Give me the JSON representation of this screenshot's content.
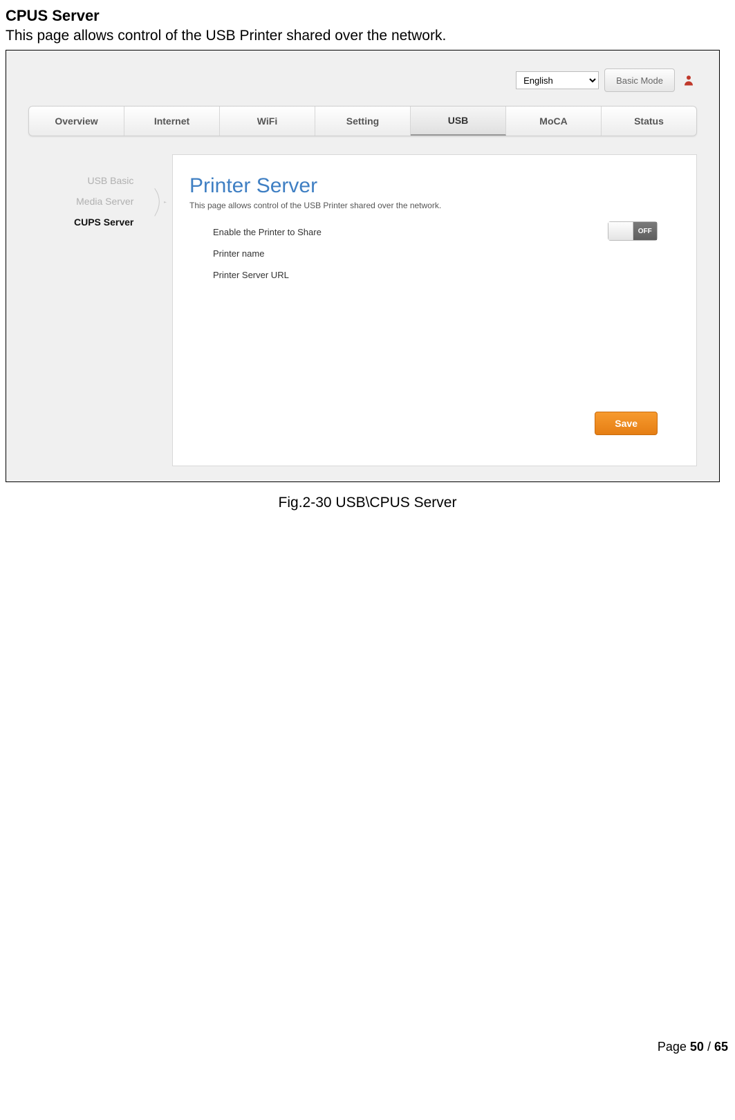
{
  "doc": {
    "section_title": "CPUS Server",
    "section_desc": "This page allows control of the USB Printer shared over the network.",
    "fig_caption": "Fig.2-30 USB\\CPUS Server",
    "footer_prefix": "Page ",
    "current_page": "50",
    "sep": " / ",
    "total_pages": "65"
  },
  "topbar": {
    "language": "English",
    "basic_mode": "Basic Mode"
  },
  "tabs": [
    "Overview",
    "Internet",
    "WiFi",
    "Setting",
    "USB",
    "MoCA",
    "Status"
  ],
  "active_tab_index": 4,
  "sidemenu": {
    "items": [
      {
        "label": "USB Basic",
        "active": false
      },
      {
        "label": "Media Server",
        "active": false
      },
      {
        "label": "CUPS Server",
        "active": true
      }
    ]
  },
  "panel": {
    "title": "Printer Server",
    "subtitle": "This page allows control of the USB Printer shared over the network.",
    "row_enable": "Enable the Printer to Share",
    "row_name": "Printer name",
    "row_url": "Printer Server URL",
    "toggle_state": "OFF",
    "save": "Save"
  }
}
